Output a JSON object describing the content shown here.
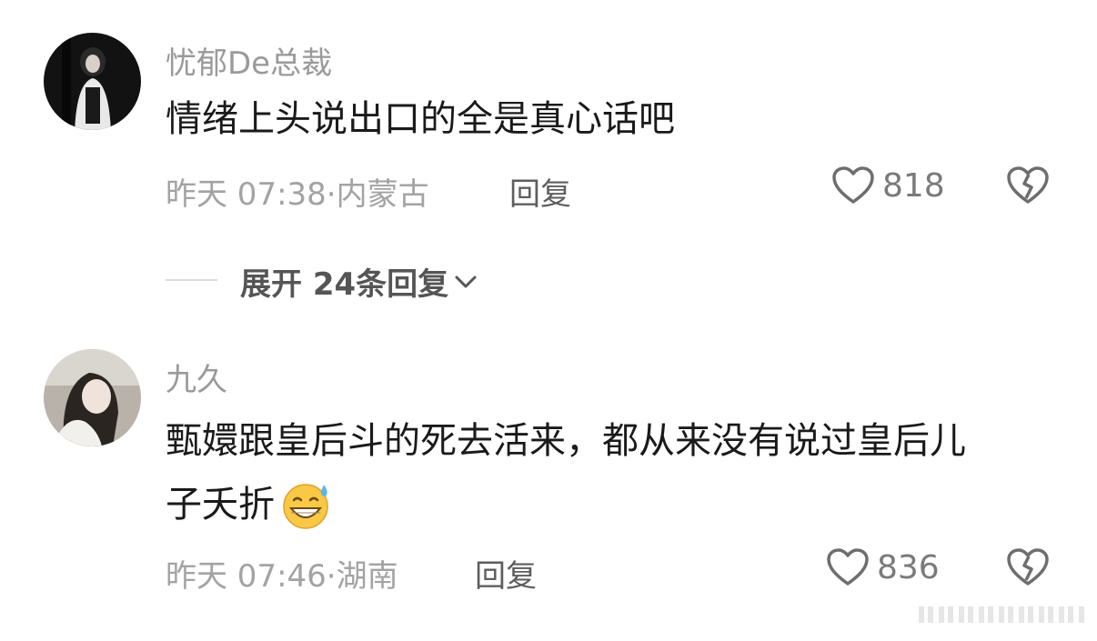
{
  "comments": [
    {
      "username": "忧郁De总裁",
      "content_lines": [
        "情绪上头说出口的全是真心话吧"
      ],
      "time": "昨天 07:38",
      "location": "内蒙古",
      "reply_label": "回复",
      "likes": "818",
      "expand_label": "展开 24条回复"
    },
    {
      "username": "九久",
      "content_lines": [
        "甄嬛跟皇后斗的死去活来，都从来没有说过皇后儿",
        "子夭折"
      ],
      "emoji": "grinning-sweat-emoji",
      "time": "昨天 07:46",
      "location": "湖南",
      "reply_label": "回复",
      "likes": "836"
    }
  ],
  "separator": "·",
  "colors": {
    "meta_gray": "#a3a3a3",
    "username_gray": "#9a9a9a",
    "text": "#1a1a1a"
  }
}
